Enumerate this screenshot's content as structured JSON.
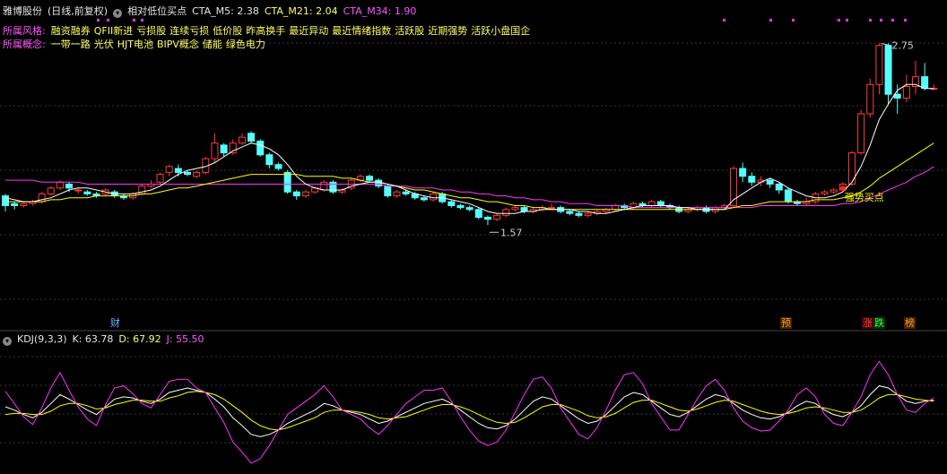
{
  "header": {
    "stock_name": "雅博股份",
    "period_label": "(日线,前复权)",
    "indicator_name": "相对低位买点",
    "m5_label": "CTA_M5: 2.38",
    "m21_label": "CTA_M21: 2.04",
    "m34_label": "CTA_M34: 1.90"
  },
  "style_row": {
    "label": "所属风格:",
    "items": [
      "融资融券",
      "QFII新进",
      "亏损股",
      "连续亏损",
      "低价股",
      "昨高换手",
      "最近异动",
      "最近情绪指数",
      "活跃股",
      "近期强势",
      "活跃小盘国企"
    ]
  },
  "concept_row": {
    "label": "所属概念:",
    "items": [
      "一带一路",
      "光伏",
      "HJT电池",
      "BIPV概念",
      "储能",
      "绿色电力"
    ]
  },
  "kdj_header": {
    "name": "KDJ(9,3,3)",
    "k": "K: 63.78",
    "d": "D: 67.92",
    "j": "J: 55.50"
  },
  "markers": {
    "high": "2.75",
    "low": "1.57",
    "signal": "强势买点",
    "cai": "财",
    "yu": "预",
    "zhang": "涨",
    "die": "跌",
    "bang": "榜"
  },
  "colors": {
    "up": "#ff3b3b",
    "down": "#54ffff",
    "m5": "#ffffff",
    "m21": "#ffff00",
    "m34": "#ff33ff",
    "k": "#ffffff",
    "d": "#ffff00",
    "j": "#ff33ff"
  },
  "chart_data": [
    {
      "type": "candlestick",
      "title": "相对低位买点",
      "ylim": [
        1.4,
        2.9
      ],
      "candles": [
        [
          1.98,
          1.93,
          1.99,
          1.9
        ],
        [
          1.94,
          1.93,
          1.95,
          1.91
        ],
        [
          1.93,
          1.94,
          1.95,
          1.92
        ],
        [
          1.94,
          1.95,
          1.96,
          1.93
        ],
        [
          1.95,
          1.99,
          2.0,
          1.94
        ],
        [
          1.99,
          2.02,
          2.03,
          1.98
        ],
        [
          2.02,
          2.05,
          2.06,
          2.01
        ],
        [
          2.04,
          2.02,
          2.05,
          2.0
        ],
        [
          2.01,
          2.01,
          2.02,
          1.99
        ],
        [
          2.0,
          1.99,
          2.01,
          1.98
        ],
        [
          1.99,
          1.98,
          2.0,
          1.97
        ],
        [
          1.99,
          2.01,
          2.02,
          1.98
        ],
        [
          2.0,
          1.98,
          2.01,
          1.97
        ],
        [
          1.98,
          1.97,
          1.99,
          1.96
        ],
        [
          1.97,
          1.99,
          2.0,
          1.96
        ],
        [
          1.99,
          2.03,
          2.04,
          1.98
        ],
        [
          2.03,
          2.04,
          2.06,
          2.02
        ],
        [
          2.05,
          2.09,
          2.1,
          2.04
        ],
        [
          2.1,
          2.13,
          2.14,
          2.08
        ],
        [
          2.12,
          2.1,
          2.14,
          2.08
        ],
        [
          2.1,
          2.09,
          2.11,
          2.08
        ],
        [
          2.08,
          2.1,
          2.11,
          2.07
        ],
        [
          2.1,
          2.17,
          2.18,
          2.09
        ],
        [
          2.17,
          2.25,
          2.3,
          2.15
        ],
        [
          2.24,
          2.2,
          2.25,
          2.18
        ],
        [
          2.2,
          2.25,
          2.27,
          2.19
        ],
        [
          2.25,
          2.28,
          2.3,
          2.24
        ],
        [
          2.3,
          2.26,
          2.31,
          2.25
        ],
        [
          2.26,
          2.19,
          2.27,
          2.18
        ],
        [
          2.19,
          2.14,
          2.2,
          2.12
        ],
        [
          2.14,
          2.12,
          2.15,
          2.11
        ],
        [
          2.1,
          2.0,
          2.11,
          1.99
        ],
        [
          2.0,
          1.98,
          2.01,
          1.96
        ],
        [
          1.98,
          2.0,
          2.01,
          1.97
        ],
        [
          2.0,
          2.02,
          2.03,
          1.99
        ],
        [
          2.01,
          2.05,
          2.06,
          2.0
        ],
        [
          2.05,
          2.0,
          2.06,
          1.99
        ],
        [
          2.0,
          2.01,
          2.02,
          1.99
        ],
        [
          2.02,
          2.06,
          2.07,
          2.01
        ],
        [
          2.06,
          2.08,
          2.09,
          2.05
        ],
        [
          2.08,
          2.06,
          2.09,
          2.05
        ],
        [
          2.06,
          2.03,
          2.07,
          2.02
        ],
        [
          2.03,
          1.98,
          2.04,
          1.97
        ],
        [
          1.98,
          2.0,
          2.01,
          1.97
        ],
        [
          2.0,
          1.99,
          2.01,
          1.98
        ],
        [
          1.99,
          1.97,
          2.0,
          1.96
        ],
        [
          1.97,
          1.96,
          1.98,
          1.95
        ],
        [
          1.96,
          1.99,
          2.0,
          1.95
        ],
        [
          1.99,
          1.95,
          2.0,
          1.94
        ],
        [
          1.95,
          1.93,
          1.96,
          1.92
        ],
        [
          1.93,
          1.92,
          1.94,
          1.91
        ],
        [
          1.92,
          1.91,
          1.93,
          1.9
        ],
        [
          1.91,
          1.87,
          1.92,
          1.86
        ],
        [
          1.87,
          1.86,
          1.88,
          1.83
        ],
        [
          1.86,
          1.88,
          1.89,
          1.85
        ],
        [
          1.88,
          1.91,
          1.92,
          1.87
        ],
        [
          1.91,
          1.92,
          1.93,
          1.9
        ],
        [
          1.92,
          1.9,
          1.93,
          1.89
        ],
        [
          1.9,
          1.91,
          1.92,
          1.89
        ],
        [
          1.91,
          1.92,
          1.93,
          1.9
        ],
        [
          1.92,
          1.92,
          1.94,
          1.91
        ],
        [
          1.92,
          1.9,
          1.93,
          1.89
        ],
        [
          1.9,
          1.89,
          1.91,
          1.88
        ],
        [
          1.89,
          1.88,
          1.9,
          1.87
        ],
        [
          1.88,
          1.89,
          1.9,
          1.87
        ],
        [
          1.89,
          1.9,
          1.91,
          1.88
        ],
        [
          1.9,
          1.91,
          1.92,
          1.89
        ],
        [
          1.91,
          1.93,
          1.94,
          1.9
        ],
        [
          1.93,
          1.92,
          1.94,
          1.91
        ],
        [
          1.92,
          1.94,
          1.95,
          1.91
        ],
        [
          1.94,
          1.93,
          1.95,
          1.92
        ],
        [
          1.93,
          1.95,
          1.96,
          1.92
        ],
        [
          1.95,
          1.93,
          1.96,
          1.92
        ],
        [
          1.93,
          1.92,
          1.94,
          1.91
        ],
        [
          1.92,
          1.9,
          1.93,
          1.89
        ],
        [
          1.9,
          1.91,
          1.92,
          1.89
        ],
        [
          1.91,
          1.92,
          1.93,
          1.9
        ],
        [
          1.92,
          1.9,
          1.93,
          1.89
        ],
        [
          1.9,
          1.92,
          1.93,
          1.89
        ],
        [
          1.92,
          1.93,
          1.94,
          1.91
        ],
        [
          1.93,
          2.12,
          2.13,
          1.92
        ],
        [
          2.12,
          2.08,
          2.15,
          2.05
        ],
        [
          2.08,
          2.05,
          2.1,
          2.03
        ],
        [
          2.05,
          2.06,
          2.08,
          2.03
        ],
        [
          2.06,
          2.04,
          2.07,
          2.02
        ],
        [
          2.04,
          2.01,
          2.05,
          1.99
        ],
        [
          2.01,
          1.95,
          2.02,
          1.94
        ],
        [
          1.95,
          1.94,
          1.96,
          1.93
        ],
        [
          1.94,
          1.95,
          1.97,
          1.93
        ],
        [
          1.95,
          1.99,
          2.0,
          1.94
        ],
        [
          1.99,
          2.0,
          2.01,
          1.98
        ],
        [
          2.0,
          2.01,
          2.02,
          1.99
        ],
        [
          2.01,
          2.04,
          2.05,
          2.0
        ],
        [
          2.04,
          2.2,
          2.21,
          2.03
        ],
        [
          2.2,
          2.4,
          2.42,
          2.19
        ],
        [
          2.4,
          2.55,
          2.58,
          2.38
        ],
        [
          2.55,
          2.75,
          2.76,
          2.5
        ],
        [
          2.75,
          2.5,
          2.76,
          2.45
        ],
        [
          2.5,
          2.48,
          2.55,
          2.4
        ],
        [
          2.48,
          2.54,
          2.6,
          2.46
        ],
        [
          2.54,
          2.59,
          2.67,
          2.5
        ],
        [
          2.59,
          2.53,
          2.66,
          2.52
        ],
        [
          2.53,
          2.53,
          2.55,
          2.52
        ]
      ],
      "ma5": [
        1.97,
        1.96,
        1.95,
        1.95,
        1.96,
        1.97,
        1.99,
        2.01,
        2.02,
        2.02,
        2.01,
        2.0,
        1.99,
        1.99,
        1.99,
        2.0,
        2.01,
        2.03,
        2.06,
        2.09,
        2.11,
        2.12,
        2.13,
        2.15,
        2.18,
        2.21,
        2.23,
        2.25,
        2.24,
        2.22,
        2.19,
        2.14,
        2.08,
        2.04,
        2.02,
        2.01,
        2.01,
        2.01,
        2.03,
        2.04,
        2.05,
        2.05,
        2.04,
        2.03,
        2.01,
        1.99,
        1.98,
        1.97,
        1.97,
        1.96,
        1.95,
        1.94,
        1.92,
        1.9,
        1.89,
        1.89,
        1.89,
        1.9,
        1.9,
        1.91,
        1.91,
        1.91,
        1.91,
        1.9,
        1.9,
        1.89,
        1.89,
        1.9,
        1.91,
        1.92,
        1.93,
        1.93,
        1.93,
        1.93,
        1.92,
        1.92,
        1.91,
        1.91,
        1.91,
        1.91,
        1.96,
        1.99,
        2.02,
        2.05,
        2.07,
        2.05,
        2.02,
        2.0,
        1.98,
        1.97,
        1.97,
        1.98,
        2.0,
        2.05,
        2.13,
        2.24,
        2.37,
        2.45,
        2.52,
        2.55,
        2.55,
        2.53,
        2.53
      ],
      "ma21": [
        1.95,
        1.95,
        1.95,
        1.95,
        1.95,
        1.96,
        1.96,
        1.97,
        1.97,
        1.97,
        1.98,
        1.98,
        1.98,
        1.98,
        1.98,
        1.99,
        1.99,
        2.0,
        2.01,
        2.02,
        2.02,
        2.03,
        2.04,
        2.05,
        2.06,
        2.07,
        2.08,
        2.09,
        2.09,
        2.09,
        2.09,
        2.09,
        2.09,
        2.08,
        2.08,
        2.08,
        2.08,
        2.07,
        2.07,
        2.06,
        2.05,
        2.05,
        2.04,
        2.03,
        2.02,
        2.01,
        2.01,
        2.0,
        1.99,
        1.98,
        1.97,
        1.97,
        1.96,
        1.95,
        1.95,
        1.94,
        1.93,
        1.93,
        1.92,
        1.92,
        1.91,
        1.91,
        1.91,
        1.91,
        1.91,
        1.91,
        1.91,
        1.91,
        1.91,
        1.91,
        1.91,
        1.91,
        1.91,
        1.91,
        1.91,
        1.91,
        1.91,
        1.91,
        1.91,
        1.91,
        1.92,
        1.93,
        1.93,
        1.94,
        1.95,
        1.95,
        1.95,
        1.95,
        1.95,
        1.96,
        1.96,
        1.96,
        1.97,
        1.98,
        2.0,
        2.03,
        2.07,
        2.1,
        2.13,
        2.16,
        2.19,
        2.22,
        2.25
      ],
      "ma34": [
        2.06,
        2.06,
        2.06,
        2.06,
        2.05,
        2.05,
        2.05,
        2.05,
        2.05,
        2.04,
        2.04,
        2.04,
        2.04,
        2.04,
        2.04,
        2.04,
        2.04,
        2.04,
        2.04,
        2.04,
        2.04,
        2.04,
        2.04,
        2.04,
        2.04,
        2.04,
        2.04,
        2.04,
        2.04,
        2.04,
        2.04,
        2.04,
        2.04,
        2.04,
        2.04,
        2.04,
        2.04,
        2.04,
        2.04,
        2.04,
        2.04,
        2.04,
        2.03,
        2.03,
        2.03,
        2.02,
        2.02,
        2.02,
        2.01,
        2.01,
        2.0,
        2.0,
        1.99,
        1.99,
        1.98,
        1.98,
        1.97,
        1.97,
        1.96,
        1.96,
        1.95,
        1.95,
        1.94,
        1.94,
        1.94,
        1.93,
        1.93,
        1.93,
        1.93,
        1.92,
        1.92,
        1.92,
        1.92,
        1.92,
        1.92,
        1.92,
        1.92,
        1.92,
        1.92,
        1.92,
        1.92,
        1.92,
        1.92,
        1.93,
        1.93,
        1.93,
        1.93,
        1.93,
        1.93,
        1.93,
        1.93,
        1.93,
        1.94,
        1.94,
        1.95,
        1.97,
        1.99,
        2.01,
        2.03,
        2.05,
        2.08,
        2.1,
        2.13
      ]
    },
    {
      "type": "line",
      "title": "KDJ(9,3,3)",
      "ylim": [
        -5,
        115
      ],
      "series": [
        {
          "name": "K",
          "values": [
            55,
            52,
            48,
            45,
            50,
            58,
            66,
            62,
            57,
            52,
            48,
            55,
            62,
            64,
            63,
            60,
            58,
            62,
            68,
            70,
            72,
            70,
            68,
            62,
            55,
            45,
            38,
            30,
            28,
            30,
            34,
            40,
            44,
            48,
            52,
            58,
            56,
            52,
            50,
            48,
            44,
            40,
            42,
            46,
            50,
            54,
            58,
            60,
            62,
            58,
            52,
            46,
            40,
            36,
            35,
            38,
            44,
            52,
            60,
            64,
            62,
            56,
            50,
            44,
            40,
            42,
            48,
            56,
            64,
            68,
            66,
            60,
            54,
            48,
            46,
            50,
            56,
            62,
            66,
            64,
            58,
            52,
            48,
            45,
            44,
            46,
            50,
            56,
            60,
            58,
            52,
            48,
            46,
            50,
            56,
            66,
            74,
            72,
            66,
            60,
            58,
            60,
            61
          ]
        },
        {
          "name": "D",
          "values": [
            48,
            49,
            49,
            48,
            48,
            51,
            56,
            58,
            58,
            56,
            53,
            54,
            57,
            59,
            61,
            61,
            60,
            60,
            63,
            65,
            68,
            69,
            68,
            66,
            62,
            56,
            50,
            43,
            38,
            35,
            34,
            36,
            39,
            42,
            45,
            50,
            52,
            52,
            51,
            50,
            48,
            45,
            44,
            45,
            46,
            49,
            52,
            55,
            57,
            57,
            55,
            52,
            48,
            44,
            41,
            40,
            41,
            45,
            50,
            55,
            57,
            57,
            54,
            51,
            47,
            45,
            46,
            49,
            54,
            59,
            61,
            61,
            58,
            55,
            52,
            51,
            53,
            56,
            59,
            61,
            60,
            57,
            54,
            51,
            49,
            48,
            49,
            51,
            54,
            55,
            54,
            52,
            50,
            50,
            52,
            57,
            63,
            66,
            66,
            64,
            62,
            61,
            60
          ]
        },
        {
          "name": "J",
          "values": [
            69,
            58,
            46,
            39,
            54,
            72,
            86,
            70,
            55,
            44,
            38,
            57,
            72,
            74,
            67,
            58,
            54,
            66,
            78,
            80,
            80,
            72,
            68,
            54,
            41,
            23,
            14,
            4,
            8,
            20,
            34,
            48,
            54,
            60,
            66,
            74,
            64,
            52,
            48,
            44,
            36,
            30,
            38,
            48,
            58,
            64,
            70,
            70,
            72,
            60,
            46,
            34,
            24,
            20,
            23,
            34,
            50,
            66,
            80,
            82,
            72,
            54,
            42,
            30,
            26,
            36,
            52,
            70,
            84,
            86,
            76,
            58,
            46,
            34,
            34,
            48,
            62,
            74,
            80,
            70,
            54,
            42,
            36,
            33,
            34,
            42,
            52,
            66,
            72,
            64,
            48,
            40,
            38,
            50,
            64,
            84,
            96,
            84,
            66,
            52,
            50,
            58,
            63
          ]
        }
      ]
    }
  ]
}
